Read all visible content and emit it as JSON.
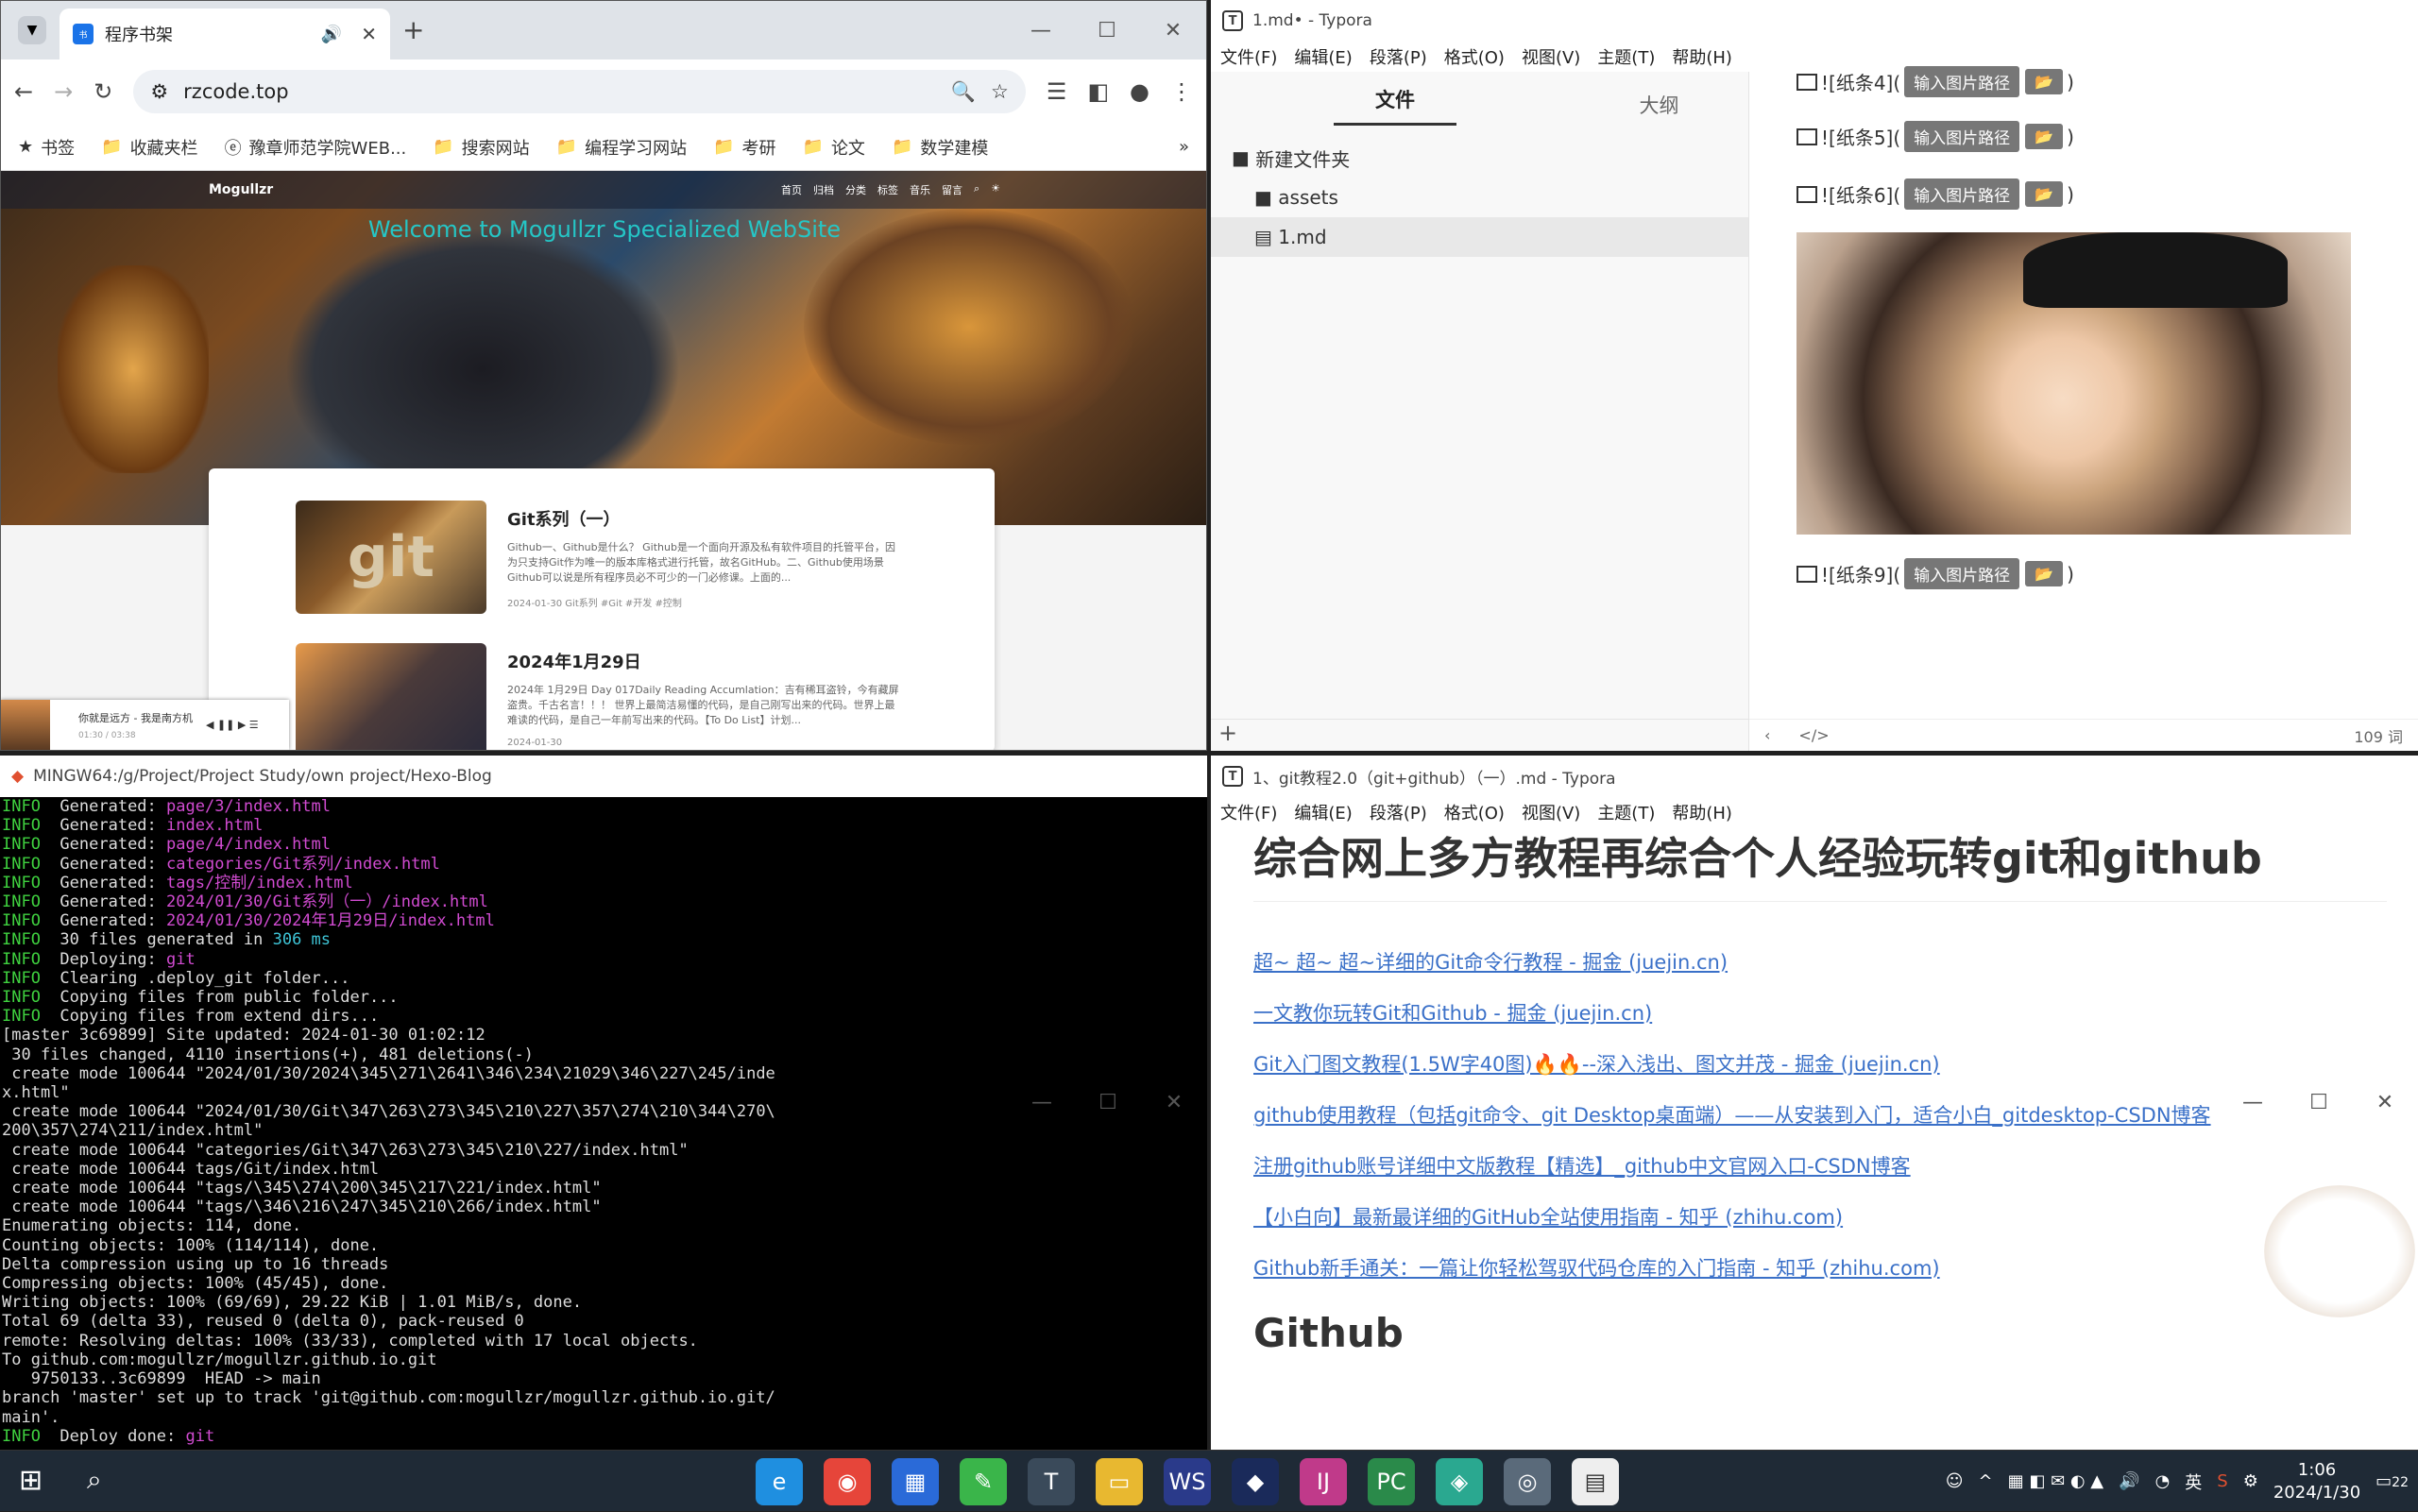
{
  "chrome": {
    "tab_title": "程序书架",
    "url": "rzcode.top",
    "bookmarks": [
      "书签",
      "收藏夹栏",
      "豫章师范学院WEB...",
      "搜索网站",
      "编程学习网站",
      "考研",
      "论文",
      "数学建模"
    ],
    "site": {
      "logo": "Mogullzr",
      "nav": [
        "首页",
        "归档",
        "分类",
        "标签",
        "音乐",
        "留言"
      ],
      "welcome": "Welcome to Mogullzr Specialized WebSite",
      "posts": [
        {
          "title": "Git系列（一）",
          "desc": "Github一、Github是什么？ Github是一个面向开源及私有软件项目的托管平台，因为只支持Git作为唯一的版本库格式进行托管，故名GitHub。二、Github使用场景 Github可以说是所有程序员必不可少的一门必修课。上面的...",
          "meta": "2024-01-30   Git系列   #Git #开发 #控制"
        },
        {
          "title": "2024年1月29日",
          "desc": "2024年 1月29日 Day 017Daily Reading Accumlation：吉有稀耳盗铃，今有藏屏盗贵。千古名言！！！ 世界上最简洁易懂的代码，是自己刚写出来的代码。世界上最难读的代码，是自己一年前写出来的代码。【To Do List】计划...",
          "meta": "2024-01-30"
        }
      ],
      "music_title": "你就是远方 - 我是南方机",
      "music_time": "01:30 / 03:38"
    }
  },
  "typora1": {
    "title": "1.md• - Typora",
    "menu": [
      "文件(F)",
      "编辑(E)",
      "段落(P)",
      "格式(O)",
      "视图(V)",
      "主题(T)",
      "帮助(H)"
    ],
    "tabs": [
      "文件",
      "大纲"
    ],
    "tree": [
      "新建文件夹",
      "assets",
      "1.md"
    ],
    "images": [
      {
        "label": "![纸条4](",
        "btn": "输入图片路径"
      },
      {
        "label": "![纸条5](",
        "btn": "输入图片路径"
      },
      {
        "label": "![纸条6](",
        "btn": "输入图片路径"
      },
      {
        "label": "![纸条9](",
        "btn": "输入图片路径"
      }
    ],
    "close_paren": ")",
    "word_count": "109 词"
  },
  "terminal": {
    "title": "MINGW64:/g/Project/Project Study/own project/Hexo-Blog"
  },
  "typora2": {
    "title": "1、git教程2.0（git+github）（一）.md - Typora",
    "heading": "综合网上多方教程再综合个人经验玩转git和github",
    "links": [
      "超~ 超~ 超~详细的Git命令行教程 - 掘金 (juejin.cn)",
      "一文教你玩转Git和Github - 掘金 (juejin.cn)",
      "Git入门图文教程(1.5W字40图)🔥🔥--深入浅出、图文并茂 - 掘金 (juejin.cn)",
      "github使用教程（包括git命令、git Desktop桌面端）——从安装到入门，适合小白_gitdesktop-CSDN博客",
      "注册github账号详细中文版教程【精选】_github中文官网入口-CSDN博客",
      "【小白向】最新最详细的GitHub全站使用指南 - 知乎 (zhihu.com)",
      "Github新手通关：一篇让你轻松驾驭代码仓库的入门指南 - 知乎 (zhihu.com)"
    ],
    "h2": "Github"
  },
  "taskbar": {
    "ime": "英",
    "time": "1:06",
    "date": "2024/1/30",
    "notif": "22"
  }
}
